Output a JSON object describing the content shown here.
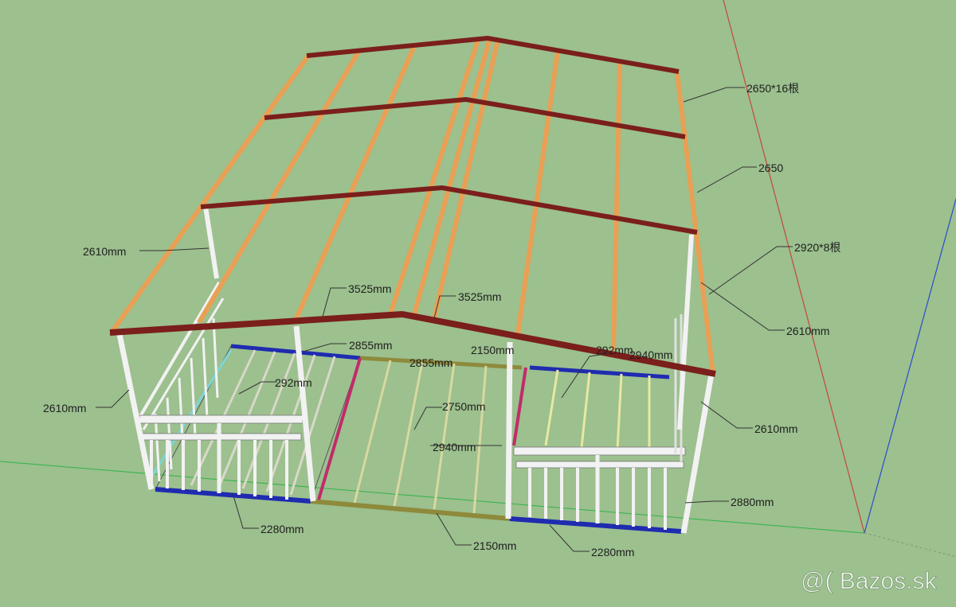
{
  "labels": {
    "roof_long_purlin": "2650*16根",
    "roof_right_purlin": "2650",
    "roof_short_purlin": "2920*8根",
    "post_left_top": "2610mm",
    "post_left_mid": "2610mm",
    "post_right_top": "2610mm",
    "post_right_mid": "2610mm",
    "rafter_left": "3525mm",
    "rafter_right": "3525mm",
    "beam_back_left": "2855mm",
    "beam_back_mid": "2855mm",
    "beam_back_mid2": "2150mm",
    "floor_left_joist": "292mm",
    "floor_mid_joist": "2750mm",
    "floor_mid_joist2": "2940mm",
    "floor_right_joist": "292mm",
    "floor_right_joist2": "2940mm",
    "front_left_beam": "2280mm",
    "front_mid_beam": "2150mm",
    "front_right_beam": "2280mm",
    "side_right_beam": "2880mm"
  },
  "watermark": "@( Bazos.sk",
  "colors": {
    "background": "#9cc08e",
    "ridge_beam": "#7a1f1b",
    "rafter": "#e9a055",
    "post": "#f2f2f2",
    "floor_beam_blue": "#1f2bb0",
    "floor_beam_olive": "#8e8a3c",
    "floor_beam_magenta": "#c22a6a",
    "guide_red": "#c24a3a",
    "guide_blue": "#2a4bd0",
    "guide_green": "#2fb34a"
  }
}
